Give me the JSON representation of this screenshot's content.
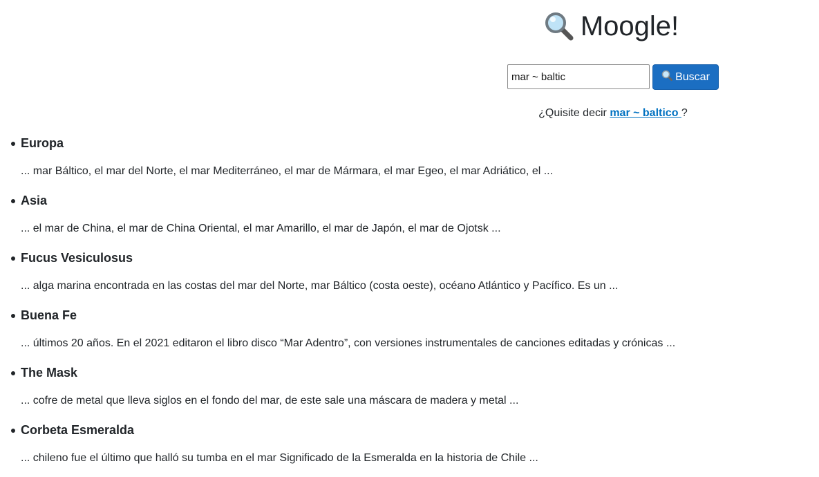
{
  "header": {
    "title": "Moogle!",
    "icon": "magnifying-glass-icon"
  },
  "search": {
    "value": "mar ~ baltic",
    "button_label": "Buscar",
    "button_icon": "magnifying-glass-icon",
    "button_color": "#1b6ec2"
  },
  "suggestion": {
    "prefix": "¿Quisite decir",
    "link_text": "mar ~ baltico",
    "suffix": "?",
    "link_color": "#0071c1"
  },
  "results": [
    {
      "title": "Europa",
      "snippet": "... mar Báltico, el mar del Norte, el mar Mediterráneo, el mar de Mármara, el mar Egeo, el mar Adriático, el ..."
    },
    {
      "title": "Asia",
      "snippet": "... el mar de China, el mar de China Oriental, el mar Amarillo, el mar de Japón, el mar de Ojotsk ..."
    },
    {
      "title": "Fucus Vesiculosus",
      "snippet": "... alga marina encontrada en las costas del mar del Norte, mar Báltico (costa oeste), océano Atlántico y Pacífico. Es un ..."
    },
    {
      "title": "Buena Fe",
      "snippet": "... últimos 20 años. En el 2021 editaron el libro disco “Mar Adentro”, con versiones instrumentales de canciones editadas y crónicas ..."
    },
    {
      "title": "The Mask",
      "snippet": "... cofre de metal que lleva siglos en el fondo del mar, de este sale una máscara de madera y metal ..."
    },
    {
      "title": "Corbeta Esmeralda",
      "snippet": "... chileno fue el último que halló su tumba en el mar  Significado de la Esmeralda en la historia de Chile ..."
    }
  ]
}
